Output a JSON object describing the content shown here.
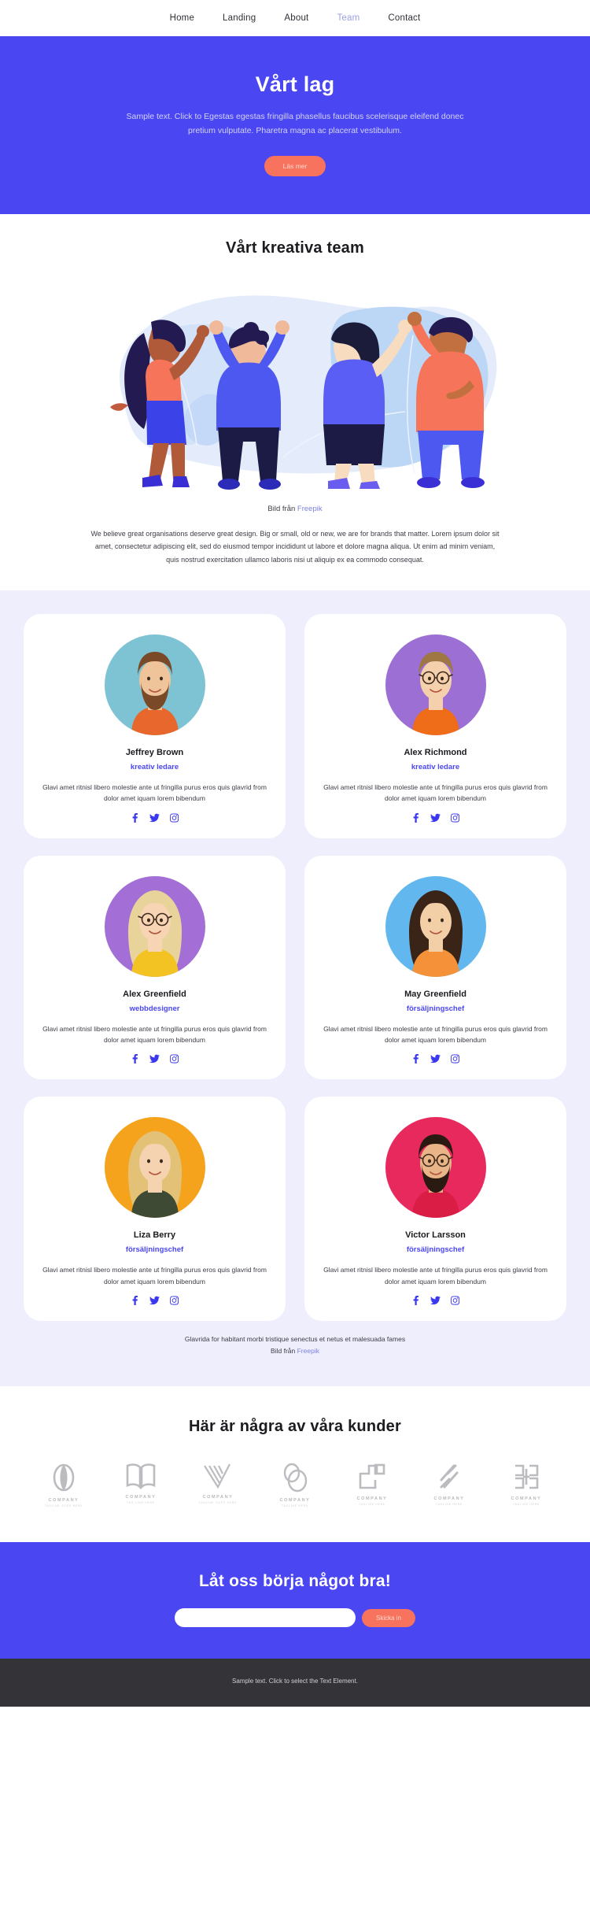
{
  "nav": {
    "items": [
      {
        "label": "Home",
        "active": false
      },
      {
        "label": "Landing",
        "active": false
      },
      {
        "label": "About",
        "active": false
      },
      {
        "label": "Team",
        "active": true
      },
      {
        "label": "Contact",
        "active": false
      }
    ]
  },
  "hero": {
    "title": "Vårt lag",
    "subtitle": "Sample text. Click to Egestas egestas fringilla phasellus faucibus scelerisque eleifend donec pretium vulputate. Pharetra magna ac placerat vestibulum.",
    "cta_label": "Läs mer"
  },
  "creative": {
    "title": "Vårt kreativa team",
    "image_credit_prefix": "Bild från",
    "image_credit_link": "Freepik",
    "lead": "We believe great organisations deserve great design. Big or small, old or new, we are for brands that matter. Lorem ipsum dolor sit amet, consectetur adipiscing elit, sed do eiusmod tempor incididunt ut labore et dolore magna aliqua. Ut enim ad minim veniam, quis nostrud exercitation ullamco laboris nisi ut aliquip ex ea commodo consequat."
  },
  "team": {
    "shared_description": "Glavi amet ritnisl libero molestie ante ut fringilla purus eros quis glavrid from dolor amet iquam lorem bibendum",
    "social_icons": [
      "facebook-icon",
      "twitter-icon",
      "instagram-icon"
    ],
    "members": [
      {
        "name": "Jeffrey Brown",
        "role": "kreativ ledare",
        "bg": "#7ec3d4",
        "shirt": "#e8672c",
        "hair": "#7a4a28",
        "skin": "#f0c49a",
        "beard": true,
        "glasses": false,
        "long_hair": false
      },
      {
        "name": "Alex Richmond",
        "role": "kreativ ledare",
        "bg": "#9b6fd4",
        "shirt": "#ef6c18",
        "hair": "#9e7744",
        "skin": "#f5d0ad",
        "beard": false,
        "glasses": true,
        "long_hair": false
      },
      {
        "name": "Alex Greenfield",
        "role": "webbdesigner",
        "bg": "#a36fd6",
        "shirt": "#f2c322",
        "hair": "#e8d49a",
        "skin": "#f6d4b4",
        "beard": false,
        "glasses": true,
        "long_hair": true
      },
      {
        "name": "May Greenfield",
        "role": "försäljningschef",
        "bg": "#62b8ee",
        "shirt": "#f59139",
        "hair": "#3a2418",
        "skin": "#f3cfa8",
        "beard": false,
        "glasses": false,
        "long_hair": true
      },
      {
        "name": "Liza Berry",
        "role": "försäljningschef",
        "bg": "#f5a31d",
        "shirt": "#3e4a33",
        "hair": "#e3c277",
        "skin": "#f5d2b0",
        "beard": false,
        "glasses": false,
        "long_hair": true
      },
      {
        "name": "Victor Larsson",
        "role": "försäljningschef",
        "bg": "#e8295e",
        "shirt": "#d91d44",
        "hair": "#2a1a12",
        "skin": "#e8b488",
        "beard": true,
        "glasses": true,
        "long_hair": false
      }
    ],
    "footer_line1": "Glavrida for habitant morbi tristique senectus et netus et malesuada fames",
    "footer_credit_prefix": "Bild från",
    "footer_credit_link": "Freepik"
  },
  "clients": {
    "title": "Här är några av våra kunder",
    "logos": [
      {
        "name": "COMPANY",
        "tagline": "TAGLINE GOES HERE",
        "icon": "company-oval-icon"
      },
      {
        "name": "COMPANY",
        "tagline": "TAG LINE HERE",
        "icon": "company-book-icon"
      },
      {
        "name": "COMPANY",
        "tagline": "TAGLINE GOES HERE",
        "icon": "company-v-icon"
      },
      {
        "name": "COMPANY",
        "tagline": "TAGLINE HERE",
        "icon": "company-rings-icon"
      },
      {
        "name": "COMPANY",
        "tagline": "TAGLINE HERE",
        "icon": "company-squares-icon"
      },
      {
        "name": "COMPANY",
        "tagline": "TAGLINE HERE",
        "icon": "company-slash-icon"
      },
      {
        "name": "COMPANY",
        "tagline": "TAGLINE HERE",
        "icon": "company-block-icon"
      }
    ]
  },
  "cta": {
    "title": "Låt oss börja något bra!",
    "input_value": "",
    "input_placeholder": "",
    "submit_label": "Skicka in"
  },
  "footer": {
    "text": "Sample text. Click to select the Text Element."
  },
  "colors": {
    "brand_blue": "#4a46f2",
    "accent_coral": "#f8735e",
    "team_bg": "#eeeefc",
    "footer_bg": "#333338",
    "link_purple": "#7d82dd"
  }
}
